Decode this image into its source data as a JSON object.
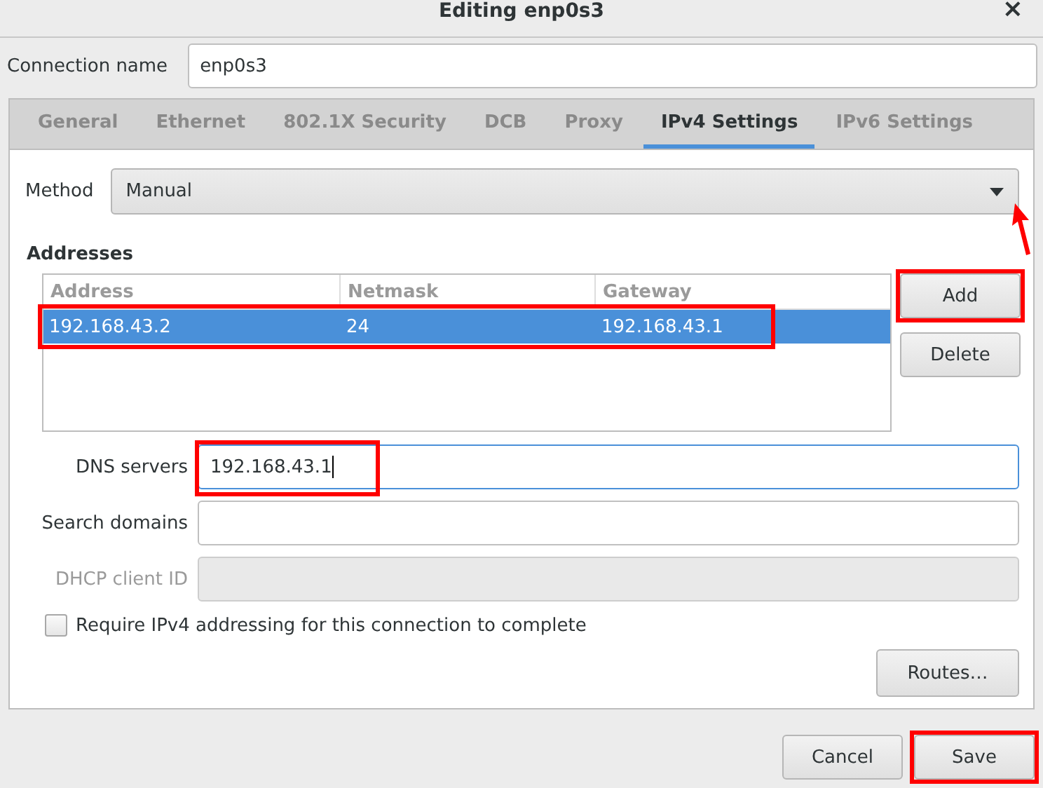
{
  "window": {
    "title": "Editing enp0s3",
    "close": "×"
  },
  "connection_name": {
    "label": "Connection name",
    "value": "enp0s3"
  },
  "tabs": [
    {
      "label": "General",
      "selected": false
    },
    {
      "label": "Ethernet",
      "selected": false
    },
    {
      "label": "802.1X Security",
      "selected": false
    },
    {
      "label": "DCB",
      "selected": false
    },
    {
      "label": "Proxy",
      "selected": false
    },
    {
      "label": "IPv4 Settings",
      "selected": true
    },
    {
      "label": "IPv6 Settings",
      "selected": false
    }
  ],
  "method": {
    "label": "Method",
    "value": "Manual",
    "arrow_annotation": true
  },
  "addresses": {
    "title": "Addresses",
    "columns": [
      "Address",
      "Netmask",
      "Gateway"
    ],
    "rows": [
      {
        "cells": [
          "192.168.43.2",
          "24",
          "192.168.43.1"
        ],
        "selected": true,
        "highlighted": true
      }
    ],
    "buttons": [
      {
        "label": "Add",
        "highlighted": true
      },
      {
        "label": "Delete",
        "highlighted": false
      }
    ]
  },
  "fields": [
    {
      "label": "DNS servers",
      "value": "192.168.43.1",
      "focused": true,
      "disabled": false,
      "highlighted": true
    },
    {
      "label": "Search domains",
      "focused": false,
      "disabled": false,
      "highlighted": false
    },
    {
      "label": "DHCP client ID",
      "focused": false,
      "disabled": true,
      "highlighted": false
    }
  ],
  "require_checkbox": {
    "label": "Require IPv4 addressing for this connection to complete",
    "checked": false
  },
  "routes_button": "Routes…",
  "footer_buttons": [
    {
      "label": "Cancel",
      "highlighted": false
    },
    {
      "label": "Save",
      "highlighted": true
    }
  ]
}
